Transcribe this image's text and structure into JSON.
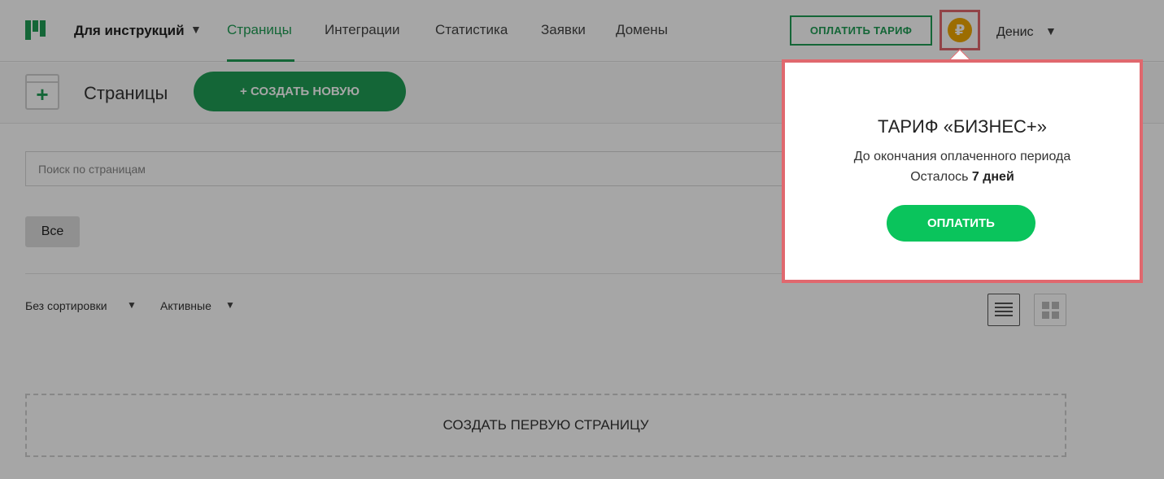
{
  "nav": {
    "workspace": "Для инструкций",
    "caret": "▼",
    "links": [
      "Страницы",
      "Интеграции",
      "Статистика",
      "Заявки",
      "Домены"
    ],
    "pay_tariff": "ОПЛАТИТЬ ТАРИФ",
    "ruble_icon": "ruble-coin-icon",
    "ruble_symbol": "₽",
    "user": "Денис"
  },
  "subheader": {
    "title": "Страницы",
    "create_new": "+ СОЗДАТЬ НОВУЮ"
  },
  "main": {
    "search_placeholder": "Поиск по страницам",
    "chip_all": "Все",
    "sort": "Без сортировки",
    "filter": "Активные",
    "first_page": "СОЗДАТЬ ПЕРВУЮ СТРАНИЦУ"
  },
  "popup": {
    "title": "ТАРИФ «БИЗНЕС+»",
    "line1": "До окончания оплаченного периода",
    "line2_prefix": "Осталось ",
    "line2_value": "7 дней",
    "pay_button": "ОПЛАТИТЬ"
  },
  "colors": {
    "accent": "#1f9d55",
    "pay_green": "#0ac45c",
    "highlight": "#e0686e",
    "ruble": "#f0a800"
  }
}
